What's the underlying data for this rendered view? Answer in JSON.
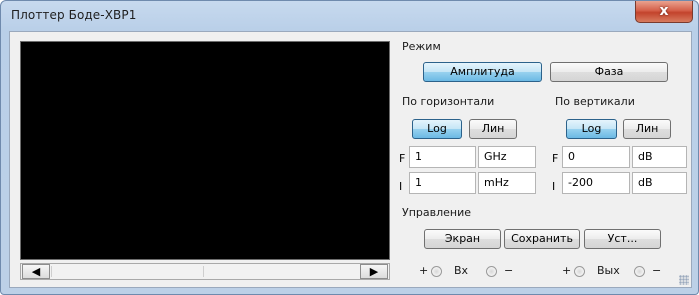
{
  "window": {
    "title": "Плоттер Боде-XBP1",
    "close_glyph": "x"
  },
  "mode": {
    "label": "Режим",
    "amplitude_label": "Амплитуда",
    "amplitude_active": true,
    "phase_label": "Фаза",
    "phase_active": false
  },
  "horizontal": {
    "label": "По горизонтали",
    "log_label": "Log",
    "log_active": true,
    "lin_label": "Лин",
    "final_prefix": "F",
    "final_value": "1",
    "final_unit": "GHz",
    "initial_prefix": "I",
    "initial_value": "1",
    "initial_unit": "mHz"
  },
  "vertical": {
    "label": "По вертикали",
    "log_label": "Log",
    "log_active": true,
    "lin_label": "Лин",
    "final_prefix": "F",
    "final_value": "0",
    "final_unit": "dB",
    "initial_prefix": "I",
    "initial_value": "-200",
    "initial_unit": "dB"
  },
  "control": {
    "label": "Управление",
    "screen_label": "Экран",
    "save_label": "Сохранить",
    "setup_label": "Уст..."
  },
  "terminals": {
    "plus": "+",
    "minus": "−",
    "in_label": "Вх",
    "out_label": "Вых"
  },
  "scrollbar": {
    "left_glyph": "🡐",
    "right_glyph": "🡒"
  },
  "colors": {
    "active_button": "#98d1ef",
    "screen": "#000000",
    "close_button": "#c3432c"
  }
}
